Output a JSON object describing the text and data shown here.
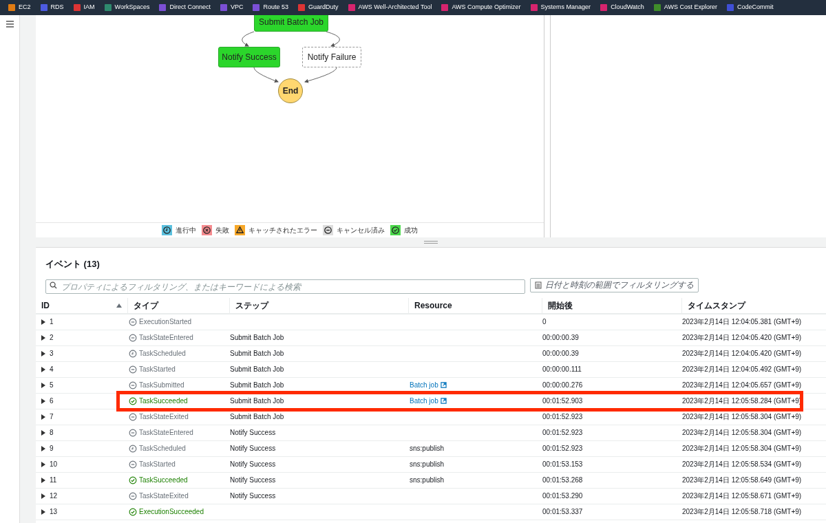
{
  "nav_bar": {
    "services": [
      {
        "label": "EC2",
        "color": "#e07b13"
      },
      {
        "label": "RDS",
        "color": "#4d5be0"
      },
      {
        "label": "IAM",
        "color": "#dd3434"
      },
      {
        "label": "WorkSpaces",
        "color": "#2e8a6e"
      },
      {
        "label": "Direct Connect",
        "color": "#7b4fd6"
      },
      {
        "label": "VPC",
        "color": "#7b4fd6"
      },
      {
        "label": "Route 53",
        "color": "#7b4fd6"
      },
      {
        "label": "GuardDuty",
        "color": "#dd3434"
      },
      {
        "label": "AWS Well-Architected Tool",
        "color": "#d6246e"
      },
      {
        "label": "AWS Compute Optimizer",
        "color": "#d6246e"
      },
      {
        "label": "Systems Manager",
        "color": "#d6246e"
      },
      {
        "label": "CloudWatch",
        "color": "#d6246e"
      },
      {
        "label": "AWS Cost Explorer",
        "color": "#3f8c2a"
      },
      {
        "label": "CodeCommit",
        "color": "#3f4fd6"
      }
    ]
  },
  "graph": {
    "nodes": [
      {
        "label": "Submit Batch Job",
        "kind": "succeeded"
      },
      {
        "label": "Notify Success",
        "kind": "succeeded"
      },
      {
        "label": "Notify Failure",
        "kind": "not_started"
      },
      {
        "label": "End",
        "kind": "end"
      }
    ],
    "legend": [
      {
        "label": "進行中",
        "kind": "in_progress",
        "color": "#5bc0de"
      },
      {
        "label": "失敗",
        "kind": "failed",
        "color": "#f58b8f"
      },
      {
        "label": "キャッチされたエラー",
        "kind": "caught_error",
        "color": "#f7a829"
      },
      {
        "label": "キャンセル済み",
        "kind": "cancelled",
        "color": "#dddddd"
      },
      {
        "label": "成功",
        "kind": "succeeded",
        "color": "#4cd94c"
      }
    ]
  },
  "events": {
    "title": "イベント (13)",
    "search": {
      "placeholder": "プロパティによるフィルタリング、またはキーワードによる検索"
    },
    "date_filter": "日付と時刻の範囲でフィルタリングする",
    "columns": [
      {
        "label": "ID",
        "sorted": true
      },
      {
        "label": "タイプ",
        "sorted": false
      },
      {
        "label": "ステップ",
        "sorted": false
      },
      {
        "label": "Resource",
        "sorted": false
      },
      {
        "label": "開始後",
        "sorted": false
      },
      {
        "label": "タイムスタンプ",
        "sorted": false
      }
    ],
    "rows": [
      {
        "id": "1",
        "type": "ExecutionStarted",
        "kind": "neutral",
        "step": "",
        "resource": "",
        "elapsed": "0",
        "timestamp": "2023年2月14日 12:04:05.381 (GMT+9)",
        "highlighted": false
      },
      {
        "id": "2",
        "type": "TaskStateEntered",
        "kind": "neutral",
        "step": "Submit Batch Job",
        "resource": "",
        "elapsed": "00:00:00.39",
        "timestamp": "2023年2月14日 12:04:05.420 (GMT+9)",
        "highlighted": false
      },
      {
        "id": "3",
        "type": "TaskScheduled",
        "kind": "scheduled",
        "step": "Submit Batch Job",
        "resource": "",
        "elapsed": "00:00:00.39",
        "timestamp": "2023年2月14日 12:04:05.420 (GMT+9)",
        "highlighted": false
      },
      {
        "id": "4",
        "type": "TaskStarted",
        "kind": "neutral",
        "step": "Submit Batch Job",
        "resource": "",
        "elapsed": "00:00:00.111",
        "timestamp": "2023年2月14日 12:04:05.492 (GMT+9)",
        "highlighted": false
      },
      {
        "id": "5",
        "type": "TaskSubmitted",
        "kind": "neutral",
        "step": "Submit Batch Job",
        "resource": "Batch job",
        "resource_is_link": true,
        "elapsed": "00:00:00.276",
        "timestamp": "2023年2月14日 12:04:05.657 (GMT+9)",
        "highlighted": false
      },
      {
        "id": "6",
        "type": "TaskSucceeded",
        "kind": "succeeded",
        "step": "Submit Batch Job",
        "resource": "Batch job",
        "resource_is_link": true,
        "elapsed": "00:01:52.903",
        "timestamp": "2023年2月14日 12:05:58.284 (GMT+9)",
        "highlighted": true
      },
      {
        "id": "7",
        "type": "TaskStateExited",
        "kind": "neutral",
        "step": "Submit Batch Job",
        "resource": "",
        "elapsed": "00:01:52.923",
        "timestamp": "2023年2月14日 12:05:58.304 (GMT+9)",
        "highlighted": false
      },
      {
        "id": "8",
        "type": "TaskStateEntered",
        "kind": "neutral",
        "step": "Notify Success",
        "resource": "",
        "elapsed": "00:01:52.923",
        "timestamp": "2023年2月14日 12:05:58.304 (GMT+9)",
        "highlighted": false
      },
      {
        "id": "9",
        "type": "TaskScheduled",
        "kind": "scheduled",
        "step": "Notify Success",
        "resource": "sns:publish",
        "resource_is_link": false,
        "elapsed": "00:01:52.923",
        "timestamp": "2023年2月14日 12:05:58.304 (GMT+9)",
        "highlighted": false
      },
      {
        "id": "10",
        "type": "TaskStarted",
        "kind": "neutral",
        "step": "Notify Success",
        "resource": "sns:publish",
        "resource_is_link": false,
        "elapsed": "00:01:53.153",
        "timestamp": "2023年2月14日 12:05:58.534 (GMT+9)",
        "highlighted": false
      },
      {
        "id": "11",
        "type": "TaskSucceeded",
        "kind": "succeeded",
        "step": "Notify Success",
        "resource": "sns:publish",
        "resource_is_link": false,
        "elapsed": "00:01:53.268",
        "timestamp": "2023年2月14日 12:05:58.649 (GMT+9)",
        "highlighted": false
      },
      {
        "id": "12",
        "type": "TaskStateExited",
        "kind": "neutral",
        "step": "Notify Success",
        "resource": "",
        "elapsed": "00:01:53.290",
        "timestamp": "2023年2月14日 12:05:58.671 (GMT+9)",
        "highlighted": false
      },
      {
        "id": "13",
        "type": "ExecutionSucceeded",
        "kind": "succeeded",
        "step": "",
        "resource": "",
        "elapsed": "00:01:53.337",
        "timestamp": "2023年2月14日 12:05:58.718 (GMT+9)",
        "highlighted": false
      }
    ]
  }
}
